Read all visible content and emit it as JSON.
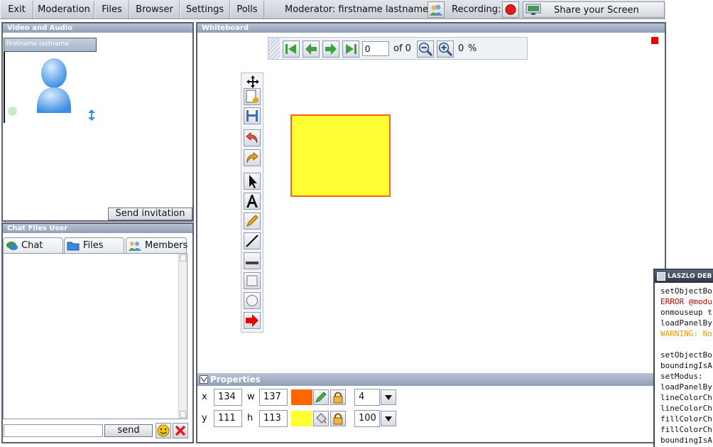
{
  "menubar": {
    "items": [
      "Exit",
      "Moderation",
      "Files",
      "Browser",
      "Settings",
      "Polls"
    ],
    "moderator_text": "Moderator: firstname lastname",
    "recording_label": "Recording:",
    "share_label": "Share your Screen"
  },
  "video_panel": {
    "title": "Video and Audio",
    "user_name": "firstname lastname",
    "send_invitation": "Send invitation"
  },
  "chat_panel": {
    "title": "Chat Files User",
    "tabs": [
      "Chat",
      "Files",
      "Members"
    ],
    "send_label": "send",
    "input_value": ""
  },
  "whiteboard": {
    "title": "Whiteboard",
    "page_value": "0",
    "of_label": "of 0",
    "zoom_value": "0",
    "zoom_unit": "%"
  },
  "properties": {
    "title": "Properties",
    "x_label": "x",
    "x_value": "134",
    "w_label": "w",
    "w_value": "137",
    "y_label": "y",
    "y_value": "111",
    "h_label": "h",
    "h_value": "113",
    "line_width": "4",
    "fill_opacity": "100",
    "line_color": "#ff6600",
    "fill_color": "#ffff33"
  },
  "debugger": {
    "title": "LASZLO DEB",
    "lines": [
      {
        "text": "setObjectBo",
        "level": "normal"
      },
      {
        "text": "ERROR @modu",
        "level": "error"
      },
      {
        "text": "onmouseup t",
        "level": "normal"
      },
      {
        "text": "loadPanelBy",
        "level": "normal"
      },
      {
        "text": "WARNING: No",
        "level": "warning"
      },
      {
        "text": "",
        "level": "normal"
      },
      {
        "text": "setObjectBo",
        "level": "normal"
      },
      {
        "text": "boundingIsA",
        "level": "normal"
      },
      {
        "text": "setModus:",
        "level": "normal"
      },
      {
        "text": "loadPanelBy",
        "level": "normal"
      },
      {
        "text": "lineColorCh",
        "level": "normal"
      },
      {
        "text": "lineColorCh",
        "level": "normal"
      },
      {
        "text": "fillColorCh",
        "level": "normal"
      },
      {
        "text": "fillColorCh",
        "level": "normal"
      },
      {
        "text": "boundingIsA",
        "level": "normal"
      }
    ]
  }
}
